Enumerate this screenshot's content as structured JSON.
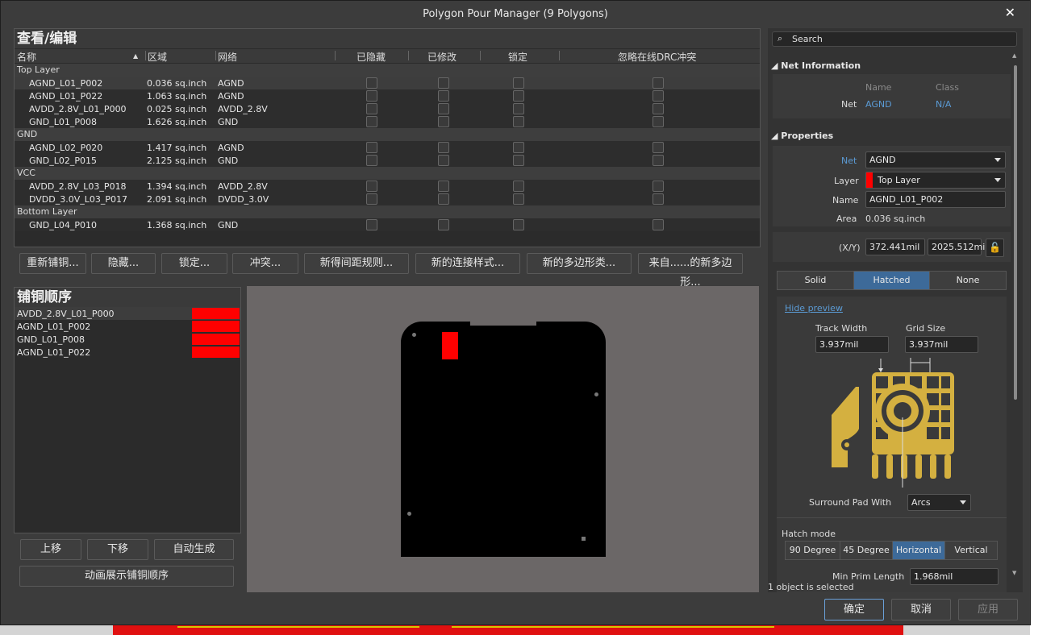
{
  "window": {
    "title": "Polygon Pour Manager (9 Polygons)",
    "close": "✕"
  },
  "edit": {
    "title": "查看/编辑",
    "columns": {
      "name": "名称",
      "area": "区域",
      "net": "网络",
      "hidden": "已隐藏",
      "modified": "已修改",
      "locked": "锁定",
      "ignore_drc": "忽略在线DRC冲突"
    },
    "groups": [
      {
        "label": "Top Layer",
        "items": [
          {
            "name": "AGND_L01_P002",
            "area": "0.036 sq.inch",
            "net": "AGND"
          },
          {
            "name": "AGND_L01_P022",
            "area": "1.063 sq.inch",
            "net": "AGND"
          },
          {
            "name": "AVDD_2.8V_L01_P000",
            "area": "0.025 sq.inch",
            "net": "AVDD_2.8V"
          },
          {
            "name": "GND_L01_P008",
            "area": "1.626 sq.inch",
            "net": "GND"
          }
        ]
      },
      {
        "label": "GND",
        "items": [
          {
            "name": "AGND_L02_P020",
            "area": "1.417 sq.inch",
            "net": "AGND"
          },
          {
            "name": "GND_L02_P015",
            "area": "2.125 sq.inch",
            "net": "GND"
          }
        ]
      },
      {
        "label": "VCC",
        "items": [
          {
            "name": "AVDD_2.8V_L03_P018",
            "area": "1.394 sq.inch",
            "net": "AVDD_2.8V"
          },
          {
            "name": "DVDD_3.0V_L03_P017",
            "area": "2.091 sq.inch",
            "net": "DVDD_3.0V"
          }
        ]
      },
      {
        "label": "Bottom Layer",
        "items": [
          {
            "name": "GND_L04_P010",
            "area": "1.368 sq.inch",
            "net": "GND"
          }
        ]
      }
    ],
    "buttons": [
      "重新铺铜...",
      "隐藏...",
      "锁定...",
      "冲突...",
      "新得间距规则...",
      "新的连接样式...",
      "新的多边形类...",
      "来自......的新多边形..."
    ]
  },
  "order": {
    "title": "铺铜顺序",
    "items": [
      "AVDD_2.8V_L01_P000",
      "AGND_L01_P002",
      "GND_L01_P008",
      "AGND_L01_P022"
    ],
    "swatch_color": "#ff0000",
    "up": "上移",
    "down": "下移",
    "auto": "自动生成",
    "animate": "动画展示铺铜顺序"
  },
  "right": {
    "search_placeholder": "Search",
    "net_info": {
      "title": "Net Information",
      "name_hdr": "Name",
      "class_hdr": "Class",
      "row_label": "Net",
      "net_value": "AGND",
      "class_value": "N/A"
    },
    "properties": {
      "title": "Properties",
      "net_label": "Net",
      "net_value": "AGND",
      "layer_label": "Layer",
      "layer_value": "Top Layer",
      "layer_color": "#ff0000",
      "name_label": "Name",
      "name_value": "AGND_L01_P002",
      "area_label": "Area",
      "area_value": "0.036 sq.inch",
      "xy_label": "(X/Y)",
      "x_value": "372.441mil",
      "y_value": "2025.512mi"
    },
    "fill_modes": [
      "Solid",
      "Hatched",
      "None"
    ],
    "fill_selected": "Hatched",
    "hide_preview": "Hide preview",
    "track_width_label": "Track Width",
    "track_width": "3.937mil",
    "grid_size_label": "Grid Size",
    "grid_size": "3.937mil",
    "surround_label": "Surround Pad With",
    "surround_value": "Arcs",
    "hatch_mode_label": "Hatch mode",
    "hatch_modes": [
      "90 Degree",
      "45 Degree",
      "Horizontal",
      "Vertical"
    ],
    "hatch_selected": "Horizontal",
    "min_prim_label": "Min Prim Length",
    "min_prim_value": "1.968mil",
    "status": "1 object is selected"
  },
  "dialog_buttons": {
    "ok": "确定",
    "cancel": "取消",
    "apply": "应用"
  }
}
